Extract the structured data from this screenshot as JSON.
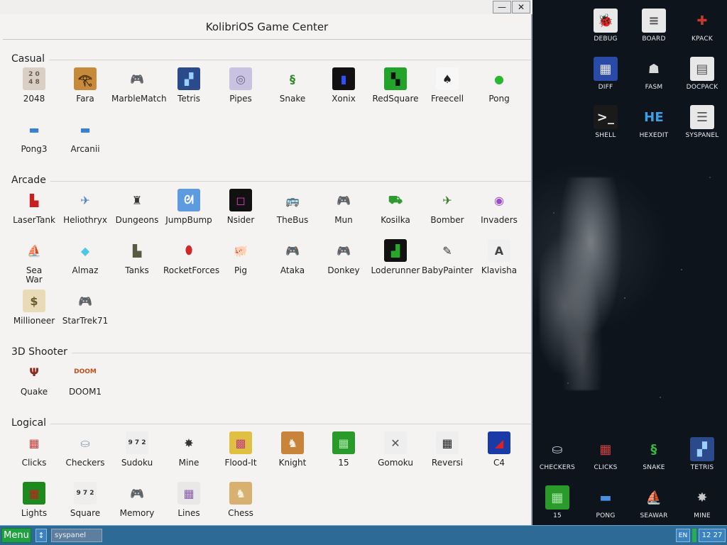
{
  "window": {
    "title": "KolibriOS Game Center",
    "minimize_label": "—",
    "close_label": "✕"
  },
  "sections": [
    {
      "title": "Casual",
      "games": [
        {
          "label": "2048",
          "icon": "grid-2048-icon",
          "glyph": "2 0\n4 8",
          "bg": "#d9cfc4",
          "fg": "#6b5b4a"
        },
        {
          "label": "Fara",
          "icon": "pharaoh-icon",
          "glyph": "𓂀",
          "bg": "#c68a3a",
          "fg": "#3a2408"
        },
        {
          "label": "MarbleMatch",
          "icon": "gamepad-icon",
          "glyph": "🎮",
          "bg": "#f4f3f1",
          "fg": "#777"
        },
        {
          "label": "Tetris",
          "icon": "tetris-icon",
          "glyph": "▞",
          "bg": "#2b4a8c",
          "fg": "#9ad0ff"
        },
        {
          "label": "Pipes",
          "icon": "pipes-icon",
          "glyph": "◎",
          "bg": "#c9c2e0",
          "fg": "#6a6a8a"
        },
        {
          "label": "Snake",
          "icon": "snake-icon",
          "glyph": "§",
          "bg": "#f4f3f1",
          "fg": "#2f8a2a"
        },
        {
          "label": "Xonix",
          "icon": "xonix-icon",
          "glyph": "▮",
          "bg": "#111111",
          "fg": "#3050ff"
        },
        {
          "label": "RedSquare",
          "icon": "redsquare-icon",
          "glyph": "▚",
          "bg": "#22a32a",
          "fg": "#111"
        },
        {
          "label": "Freecell",
          "icon": "cards-icon",
          "glyph": "♠",
          "bg": "#f7f7f7",
          "fg": "#222"
        },
        {
          "label": "Pong",
          "icon": "tennis-ball-icon",
          "glyph": "●",
          "bg": "#f4f3f1",
          "fg": "#29b82f"
        },
        {
          "label": "Pong3",
          "icon": "paddle-icon",
          "glyph": "▬",
          "bg": "#f4f3f1",
          "fg": "#3a7fd0"
        },
        {
          "label": "Arcanii",
          "icon": "paddle-icon",
          "glyph": "▬",
          "bg": "#f4f3f1",
          "fg": "#3a7fd0"
        }
      ]
    },
    {
      "title": "Arcade",
      "games": [
        {
          "label": "LaserTank",
          "icon": "tank-icon",
          "glyph": "▙",
          "bg": "#f4f3f1",
          "fg": "#c62020"
        },
        {
          "label": "Heliothryx",
          "icon": "spaceship-icon",
          "glyph": "✈",
          "bg": "#f4f3f1",
          "fg": "#4e86c6"
        },
        {
          "label": "Dungeons",
          "icon": "castle-icon",
          "glyph": "♜",
          "bg": "#f4f3f1",
          "fg": "#333"
        },
        {
          "label": "JumpBump",
          "icon": "rabbits-icon",
          "glyph": "ᘛ",
          "bg": "#5d9ae0",
          "fg": "#fff"
        },
        {
          "label": "Nsider",
          "icon": "nsider-icon",
          "glyph": "◻",
          "bg": "#111111",
          "fg": "#e040c0"
        },
        {
          "label": "TheBus",
          "icon": "bus-icon",
          "glyph": "🚌",
          "bg": "#f4f3f1",
          "fg": "#e0b010"
        },
        {
          "label": "Mun",
          "icon": "gamepad-icon",
          "glyph": "🎮",
          "bg": "#f4f3f1",
          "fg": "#777"
        },
        {
          "label": "Kosilka",
          "icon": "lawnmower-icon",
          "glyph": "⛟",
          "bg": "#f4f3f1",
          "fg": "#2e9a30"
        },
        {
          "label": "Bomber",
          "icon": "plane-icon",
          "glyph": "✈",
          "bg": "#f4f3f1",
          "fg": "#3d7a2a"
        },
        {
          "label": "Invaders",
          "icon": "ufo-icon",
          "glyph": "◉",
          "bg": "#f4f3f1",
          "fg": "#9b4bd2"
        },
        {
          "label": "Sea\nWar",
          "icon": "ship-icon",
          "glyph": "⛵",
          "bg": "#f4f3f1",
          "fg": "#6a5030"
        },
        {
          "label": "Almaz",
          "icon": "diamond-icon",
          "glyph": "◆",
          "bg": "#f4f3f1",
          "fg": "#4cc9e8"
        },
        {
          "label": "Tanks",
          "icon": "tank-icon",
          "glyph": "▙",
          "bg": "#f4f3f1",
          "fg": "#5a5a40"
        },
        {
          "label": "RocketForces",
          "icon": "bomb-icon",
          "glyph": "⬮",
          "bg": "#f4f3f1",
          "fg": "#d02828"
        },
        {
          "label": "Pig",
          "icon": "pig-icon",
          "glyph": "🐖",
          "bg": "#f4f3f1",
          "fg": "#e58b9a"
        },
        {
          "label": "Ataka",
          "icon": "gamepad-icon",
          "glyph": "🎮",
          "bg": "#f4f3f1",
          "fg": "#777"
        },
        {
          "label": "Donkey",
          "icon": "gamepad-icon",
          "glyph": "🎮",
          "bg": "#f4f3f1",
          "fg": "#777"
        },
        {
          "label": "Loderunner",
          "icon": "loderunner-icon",
          "glyph": "▟",
          "bg": "#111111",
          "fg": "#28a828"
        },
        {
          "label": "BabyPainter",
          "icon": "brush-icon",
          "glyph": "✎",
          "bg": "#f4f3f1",
          "fg": "#333"
        },
        {
          "label": "Klavisha",
          "icon": "key-a-icon",
          "glyph": "A",
          "bg": "#f0f0f0",
          "fg": "#444"
        },
        {
          "label": "Millioneer",
          "icon": "millioneer-icon",
          "glyph": "$",
          "bg": "#e8dcb8",
          "fg": "#6a5a2a"
        },
        {
          "label": "StarTrek71",
          "icon": "gamepad-icon",
          "glyph": "🎮",
          "bg": "#f4f3f1",
          "fg": "#777"
        }
      ]
    },
    {
      "title": "3D Shooter",
      "games": [
        {
          "label": "Quake",
          "icon": "quake-icon",
          "glyph": "Ψ",
          "bg": "#f4f3f1",
          "fg": "#8a2a1a"
        },
        {
          "label": "DOOM1",
          "icon": "doom-icon",
          "glyph": "DOOM",
          "bg": "#f4f3f1",
          "fg": "#c0501a"
        }
      ]
    },
    {
      "title": "Logical",
      "games": [
        {
          "label": "Clicks",
          "icon": "blocks-icon",
          "glyph": "▦",
          "bg": "#f4f3f1",
          "fg": "#d04040"
        },
        {
          "label": "Checkers",
          "icon": "checkers-icon",
          "glyph": "⛀",
          "bg": "#f4f3f1",
          "fg": "#8aa0b8"
        },
        {
          "label": "Sudoku",
          "icon": "sudoku-icon",
          "glyph": "9 7 2",
          "bg": "#eeeeee",
          "fg": "#333"
        },
        {
          "label": "Mine",
          "icon": "mine-icon",
          "glyph": "✸",
          "bg": "#f4f3f1",
          "fg": "#333"
        },
        {
          "label": "Flood-It",
          "icon": "flood-icon",
          "glyph": "▩",
          "bg": "#e0c040",
          "fg": "#c04080"
        },
        {
          "label": "Knight",
          "icon": "knight-icon",
          "glyph": "♞",
          "bg": "#c8843a",
          "fg": "#f8f0e0"
        },
        {
          "label": "15",
          "icon": "fifteen-icon",
          "glyph": "▦",
          "bg": "#2a9a2a",
          "fg": "#a8e8a8"
        },
        {
          "label": "Gomoku",
          "icon": "gomoku-icon",
          "glyph": "✕",
          "bg": "#eeeeee",
          "fg": "#555"
        },
        {
          "label": "Reversi",
          "icon": "reversi-icon",
          "glyph": "▦",
          "bg": "#eeeeee",
          "fg": "#222"
        },
        {
          "label": "C4",
          "icon": "c4-icon",
          "glyph": "◢",
          "bg": "#1a3aa8",
          "fg": "#e02020"
        },
        {
          "label": "Lights",
          "icon": "lights-icon",
          "glyph": "▦",
          "bg": "#1e8a1e",
          "fg": "#c02020"
        },
        {
          "label": "Square",
          "icon": "sudoku-icon",
          "glyph": "9 7 2",
          "bg": "#eeeeee",
          "fg": "#333"
        },
        {
          "label": "Memory",
          "icon": "gamepad-icon",
          "glyph": "🎮",
          "bg": "#f4f3f1",
          "fg": "#777"
        },
        {
          "label": "Lines",
          "icon": "lines-icon",
          "glyph": "▦",
          "bg": "#e8e8e8",
          "fg": "#8a5ab0"
        },
        {
          "label": "Chess",
          "icon": "chess-icon",
          "glyph": "♞",
          "bg": "#d8b070",
          "fg": "#f8f0e0"
        }
      ]
    }
  ],
  "desktop": {
    "top_icons": [
      {
        "label": "DEBUG",
        "icon": "debug-icon",
        "glyph": "🐞",
        "bg": "#e8e8e8",
        "fg": "#c03030"
      },
      {
        "label": "BOARD",
        "icon": "board-icon",
        "glyph": "≡",
        "bg": "#e8e8e8",
        "fg": "#555"
      },
      {
        "label": "KPACK",
        "icon": "kpack-icon",
        "glyph": "✚",
        "bg": "#0d141c",
        "fg": "#c83a2a"
      },
      {
        "label": "DIFF",
        "icon": "diff-icon",
        "glyph": "▦",
        "bg": "#2a4aa8",
        "fg": "#f0f0f0"
      },
      {
        "label": "FASM",
        "icon": "fasm-icon",
        "glyph": "☗",
        "bg": "#0d141c",
        "fg": "#d8d8d8"
      },
      {
        "label": "DOCPACK",
        "icon": "docpack-icon",
        "glyph": "▤",
        "bg": "#e8e8e8",
        "fg": "#555"
      },
      {
        "label": "SHELL",
        "icon": "shell-icon",
        "glyph": ">_",
        "bg": "#1a1a1a",
        "fg": "#e8e8e8"
      },
      {
        "label": "HEXEDIT",
        "icon": "hexedit-icon",
        "glyph": "HE",
        "bg": "#0d141c",
        "fg": "#3aa0e8"
      },
      {
        "label": "SYSPANEL",
        "icon": "syspanel-icon",
        "glyph": "☰",
        "bg": "#e8e8e8",
        "fg": "#555"
      }
    ],
    "bottom_icons": [
      {
        "label": "CHECKERS",
        "icon": "checkers-icon",
        "glyph": "⛀",
        "bg": "#0d141c",
        "fg": "#b8c8d8"
      },
      {
        "label": "CLICKS",
        "icon": "blocks-icon",
        "glyph": "▦",
        "bg": "#0d141c",
        "fg": "#d04040"
      },
      {
        "label": "SNAKE",
        "icon": "snake-icon",
        "glyph": "§",
        "bg": "#0d141c",
        "fg": "#3ab83a"
      },
      {
        "label": "TETRIS",
        "icon": "tetris-icon",
        "glyph": "▞",
        "bg": "#2b4a8c",
        "fg": "#9ad0ff"
      },
      {
        "label": "15",
        "icon": "fifteen-icon",
        "glyph": "▦",
        "bg": "#2a9a2a",
        "fg": "#a8e8a8"
      },
      {
        "label": "PONG",
        "icon": "paddle-icon",
        "glyph": "▬",
        "bg": "#0d141c",
        "fg": "#4a90e0"
      },
      {
        "label": "SEAWAR",
        "icon": "ship-icon",
        "glyph": "⛵",
        "bg": "#0d141c",
        "fg": "#d8d0c0"
      },
      {
        "label": "MINE",
        "icon": "mine-icon",
        "glyph": "✸",
        "bg": "#0d141c",
        "fg": "#c8c8c8"
      }
    ]
  },
  "taskbar": {
    "menu_label": "Menu",
    "arrow_label": "↕",
    "task_label": "syspanel",
    "lang_label": "EN",
    "clock": "12 27"
  }
}
